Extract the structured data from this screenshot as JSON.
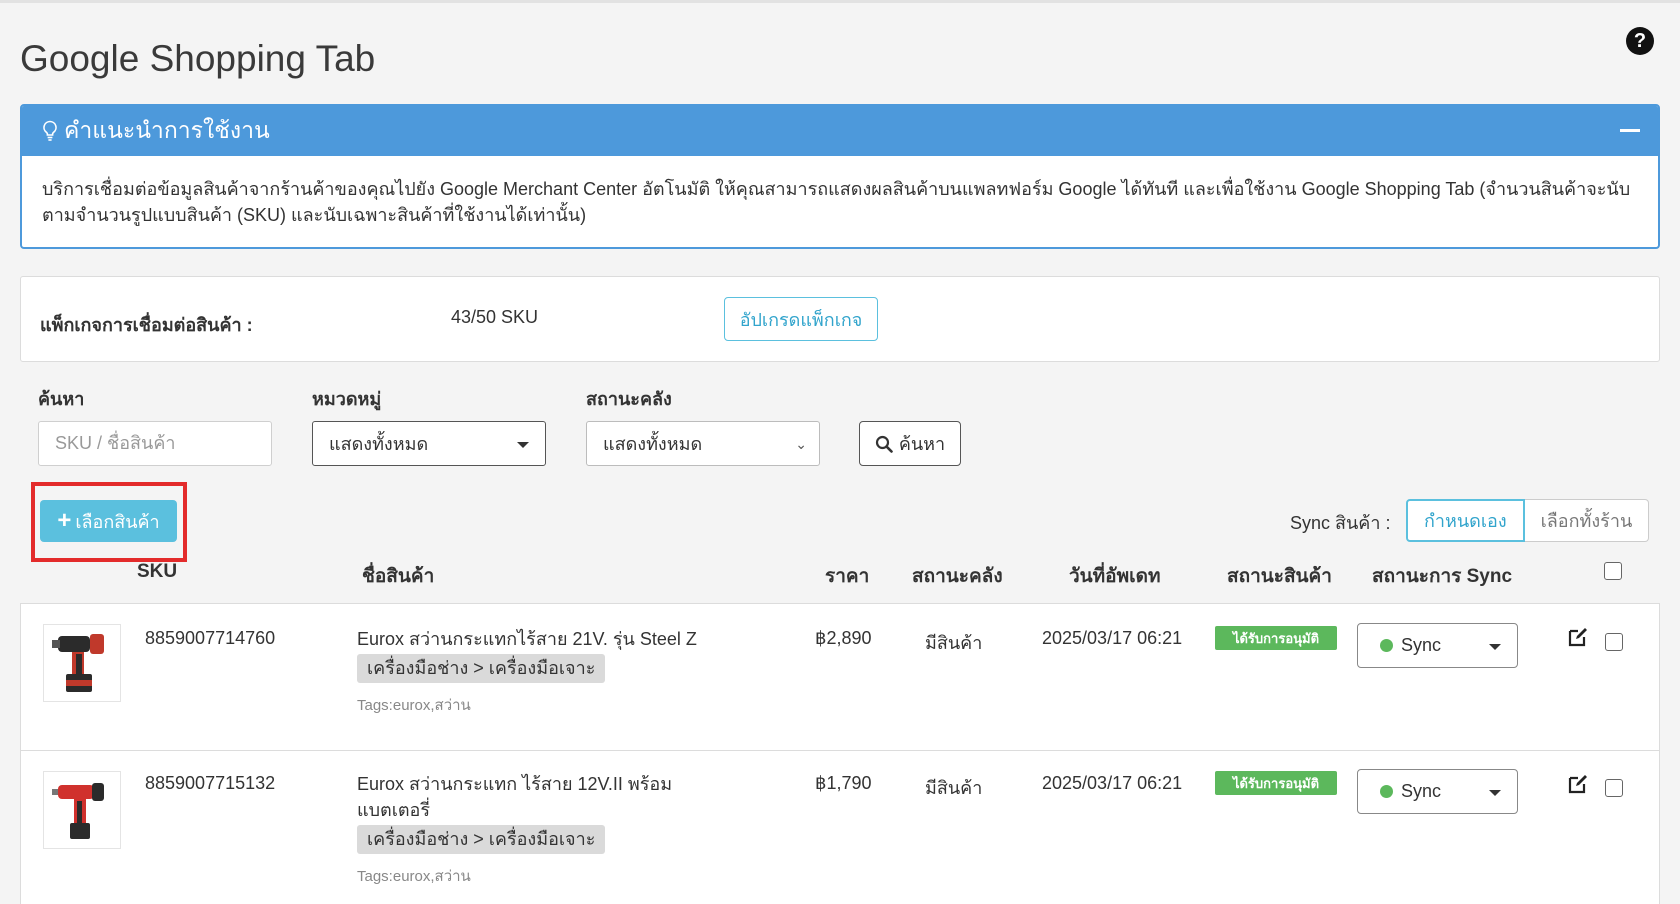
{
  "page": {
    "title": "Google Shopping Tab",
    "help_icon": "question-circle-icon"
  },
  "tips": {
    "title": "คำแนะนำการใช้งาน",
    "body": "บริการเชื่อมต่อข้อมูลสินค้าจากร้านค้าของคุณไปยัง Google Merchant Center อัตโนมัติ ให้คุณสามารถแสดงผลสินค้าบนแพลทฟอร์ม Google ได้ทันที และเพื่อใช้งาน Google Shopping Tab (จำนวนสินค้าจะนับตามจำนวนรูปแบบสินค้า (SKU) และนับเฉพาะสินค้าที่ใช้งานได้เท่านั้น)"
  },
  "package": {
    "label": "แพ็กเกจการเชื่อมต่อสินค้า :",
    "value": "43/50 SKU",
    "upgrade_label": "อัปเกรดแพ็กเกจ"
  },
  "filters": {
    "search_label": "ค้นหา",
    "search_placeholder": "SKU / ชื่อสินค้า",
    "category_label": "หมวดหมู่",
    "category_value": "แสดงทั้งหมด",
    "stock_label": "สถานะคลัง",
    "stock_value": "แสดงทั้งหมด",
    "search_button": "ค้นหา"
  },
  "actions": {
    "select_product": "เลือกสินค้า",
    "sync_label": "Sync สินค้า :",
    "sync_manual": "กำหนดเอง",
    "sync_all": "เลือกทั้งร้าน"
  },
  "table": {
    "headers": {
      "sku": "SKU",
      "name": "ชื่อสินค้า",
      "price": "ราคา",
      "stock": "สถานะคลัง",
      "updated": "วันที่อัพเดท",
      "product_status": "สถานะสินค้า",
      "sync_status": "สถานะการ Sync"
    },
    "rows": [
      {
        "sku": "8859007714760",
        "name": "Eurox สว่านกระแทกไร้สาย 21V. รุ่น Steel Z",
        "category": "เครื่องมือช่าง > เครื่องมือเจาะ",
        "tags": "Tags:eurox,สว่าน",
        "price": "฿2,890",
        "stock": "มีสินค้า",
        "updated": "2025/03/17 06:21",
        "status": "ได้รับการอนุมัติ",
        "sync": "Sync"
      },
      {
        "sku": "8859007715132",
        "name": "Eurox สว่านกระแทก ไร้สาย 12V.II พร้อมแบตเตอรี่",
        "category": "เครื่องมือช่าง > เครื่องมือเจาะ",
        "tags": "Tags:eurox,สว่าน",
        "price": "฿1,790",
        "stock": "มีสินค้า",
        "updated": "2025/03/17 06:21",
        "status": "ได้รับการอนุมัติ",
        "sync": "Sync"
      }
    ]
  },
  "colors": {
    "primary": "#4d99db",
    "info": "#5bc0de",
    "success": "#5cb85c",
    "highlight": "#e32b2b"
  }
}
